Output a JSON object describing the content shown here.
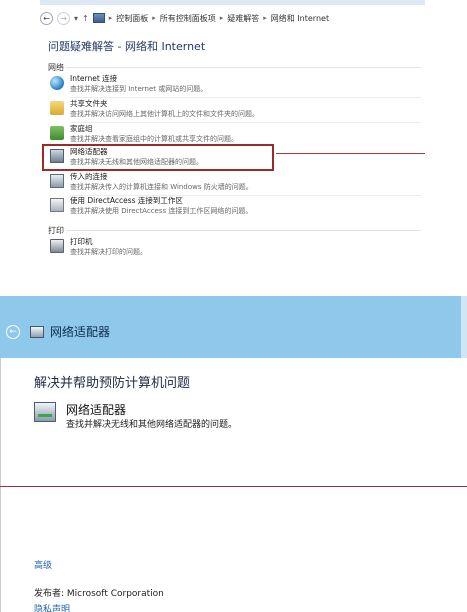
{
  "top": {
    "breadcrumb": [
      "控制面板",
      "所有控制面板项",
      "疑难解答",
      "网络和 Internet"
    ],
    "title": "问题疑难解答 - 网络和 Internet",
    "sections": {
      "network_label": "网络",
      "printing_label": "打印"
    },
    "items": [
      {
        "name": "Internet 连接",
        "desc": "查找并解决连接到 Internet 或网站的问题。",
        "icon": "globe-icon"
      },
      {
        "name": "共享文件夹",
        "desc": "查找并解决访问网络上其他计算机上的文件和文件夹的问题。",
        "icon": "folder-icon"
      },
      {
        "name": "家庭组",
        "desc": "查找并解决查看家庭组中的计算机或共享文件的问题。",
        "icon": "homegroup-icon"
      },
      {
        "name": "网络适配器",
        "desc": "查找并解决无线和其他网络适配器的问题。",
        "icon": "network-adapter-icon"
      },
      {
        "name": "传入的连接",
        "desc": "查找并解决传入的计算机连接和 Windows 防火墙的问题。",
        "icon": "incoming-connection-icon"
      },
      {
        "name": "使用 DirectAccess 连接到工作区",
        "desc": "查找并解决使用 DirectAccess 连接到工作区网络的问题。",
        "icon": "directaccess-icon"
      }
    ],
    "printer": {
      "name": "打印机",
      "desc": "查找并解决打印的问题。",
      "icon": "printer-icon"
    },
    "highlight_color": "#9b2a2a"
  },
  "bottom": {
    "window_title": "网络适配器",
    "headline": "解决并帮助预防计算机问题",
    "adapter_name": "网络适配器",
    "adapter_desc": "查找并解决无线和其他网络适配器的问题。",
    "advanced": "高级",
    "publisher": "发布者: Microsoft Corporation",
    "privacy": "隐私声明",
    "bar_color": "#8ec8ea"
  }
}
